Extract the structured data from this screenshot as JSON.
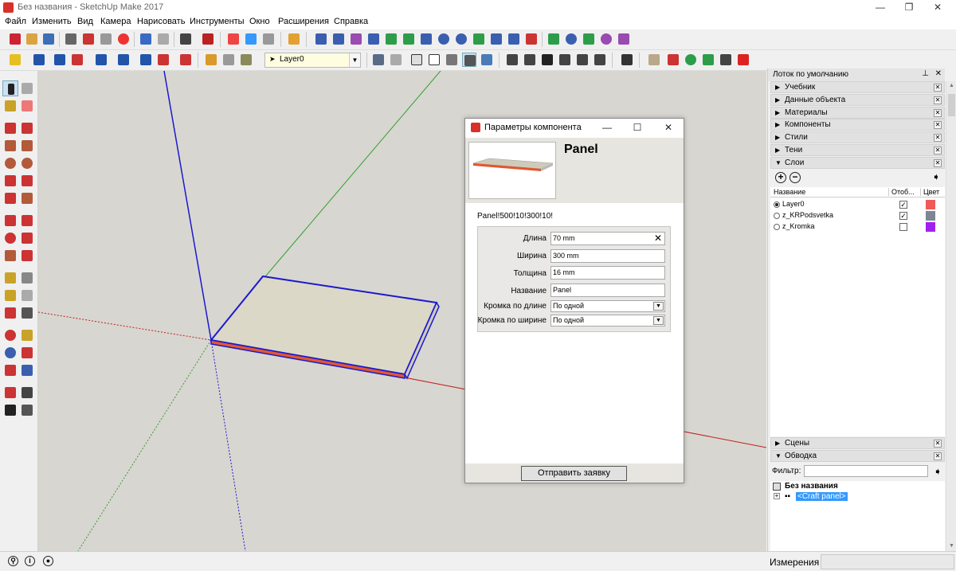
{
  "window": {
    "title": "Без названия - SketchUp Make 2017"
  },
  "menu": [
    "Файл",
    "Изменить",
    "Вид",
    "Камера",
    "Нарисовать",
    "Инструменты",
    "Окно",
    "Расширения",
    "Справка"
  ],
  "toolbar": {
    "layer_value": "Layer0"
  },
  "dialog": {
    "title": "Параметры компонента",
    "component_name": "Panel",
    "component_code": "Panel!500!10!300!10!",
    "fields": [
      {
        "label": "Длина",
        "value": "70 mm"
      },
      {
        "label": "Ширина",
        "value": "300 mm"
      },
      {
        "label": "Толщина",
        "value": "16 mm"
      },
      {
        "label": "Название",
        "value": "Panel"
      }
    ],
    "selects": [
      {
        "label": "Кромка по длине",
        "value": "По одной"
      },
      {
        "label": "Кромка по ширине",
        "value": "По одной"
      }
    ],
    "submit_label": "Отправить заявку"
  },
  "tray": {
    "title": "Лоток по умолчанию",
    "sections": [
      "Учебник",
      "Данные объекта",
      "Материалы",
      "Компоненты",
      "Стили",
      "Тени",
      "Слои"
    ],
    "layers_headers": {
      "name": "Название",
      "visible": "Отоб...",
      "color": "Цвет"
    },
    "layers": [
      {
        "name": "Layer0",
        "active": true,
        "visible": true,
        "color": "#f05a5a"
      },
      {
        "name": "z_KRPodsvetka",
        "active": false,
        "visible": true,
        "color": "#7f8592"
      },
      {
        "name": "z_Kromka",
        "active": false,
        "visible": false,
        "color": "#a020f0"
      }
    ],
    "scenes_label": "Сцены",
    "outline_label": "Обводка",
    "filter_label": "Фильтр:",
    "outline_root": "Без названия",
    "outline_child": "<Craft panel>"
  },
  "status": {
    "measurements_label": "Измерения"
  }
}
